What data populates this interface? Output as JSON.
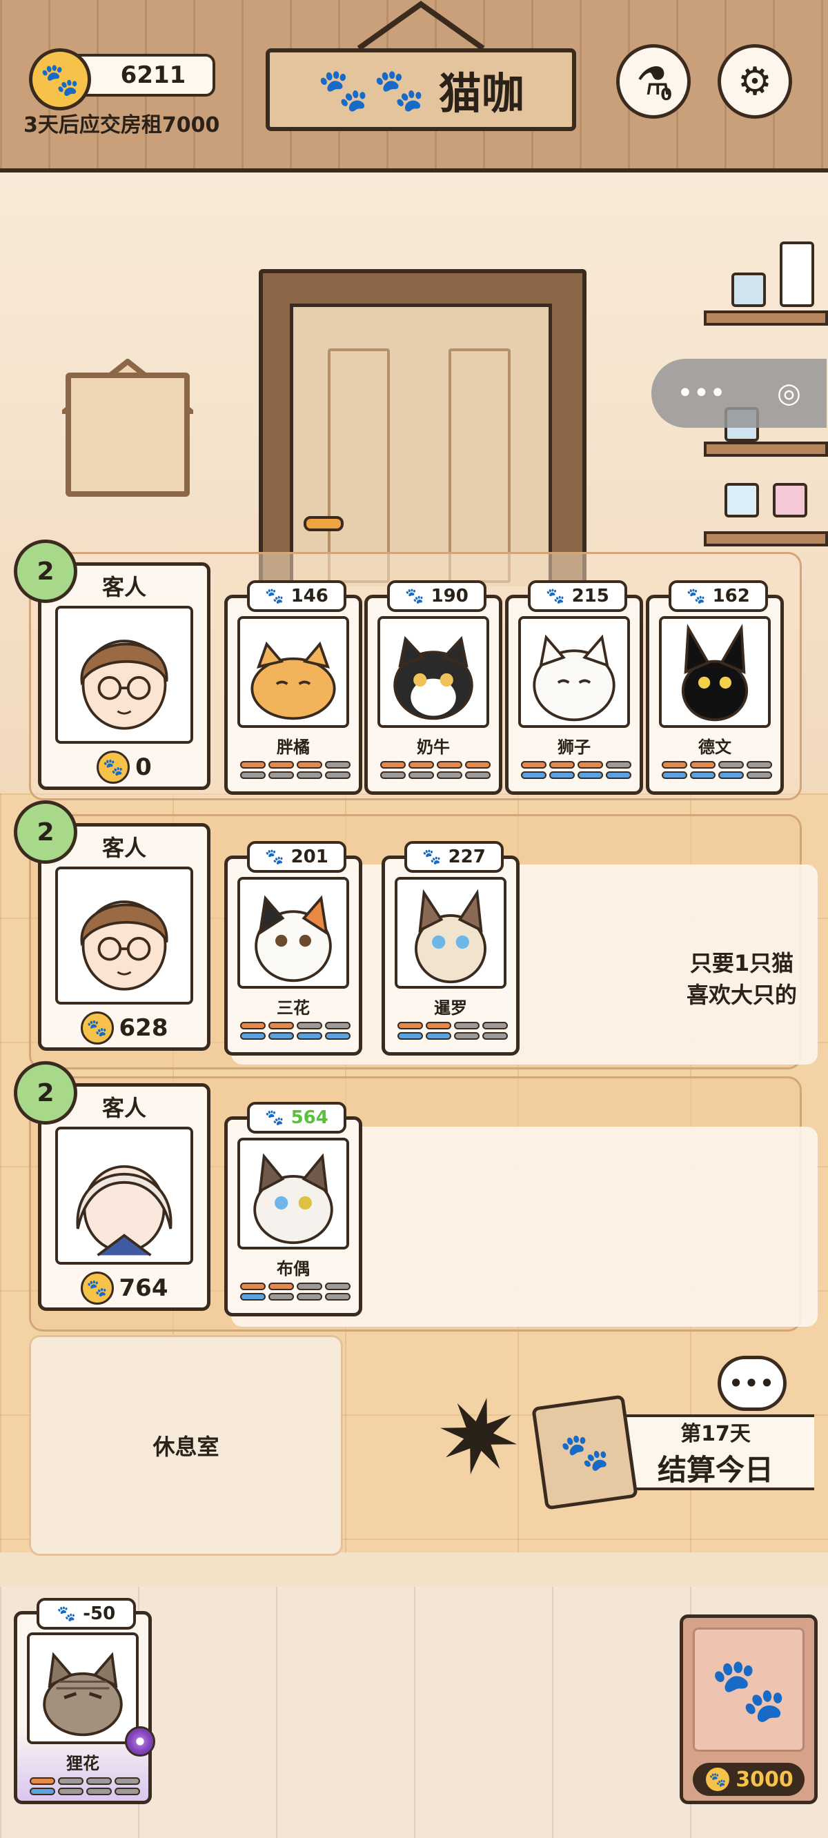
{
  "header": {
    "coins": "6211",
    "rent_notice": "3天后应交房租7000",
    "title": "猫咖",
    "title_paws": "🐾🐾",
    "potion_count": "0"
  },
  "icons": {
    "coin": "paw-coin-icon",
    "potion": "potion-icon",
    "settings": "gear-icon",
    "refresh": "refresh-icon",
    "chat": "speech-bubble-icon",
    "clipboard": "clipboard-paw-icon"
  },
  "colors": {
    "coin": "#f6c24a",
    "refresh": "#a8d88a",
    "stat_orange": "#e8874a",
    "stat_blue": "#5aa3e0",
    "stat_empty": "#9b9b9b",
    "highlight_value": "#58c23a"
  },
  "customers": [
    {
      "title": "客人",
      "refresh_count": "2",
      "coins": "0",
      "request": "",
      "cats": [
        {
          "name": "胖橘",
          "value": "146",
          "orange": 3,
          "blue": 0
        },
        {
          "name": "奶牛",
          "value": "190",
          "orange": 4,
          "blue": 0
        },
        {
          "name": "狮子",
          "value": "215",
          "orange": 3,
          "blue": 4
        },
        {
          "name": "德文",
          "value": "162",
          "orange": 2,
          "blue": 3
        }
      ]
    },
    {
      "title": "客人",
      "refresh_count": "2",
      "coins": "628",
      "request": "只要1只猫\n喜欢大只的",
      "cats": [
        {
          "name": "三花",
          "value": "201",
          "orange": 2,
          "blue": 4
        },
        {
          "name": "暹罗",
          "value": "227",
          "orange": 2,
          "blue": 2
        }
      ]
    },
    {
      "title": "客人",
      "refresh_count": "2",
      "coins": "764",
      "request": "",
      "cats": [
        {
          "name": "布偶",
          "value": "564",
          "orange": 2,
          "blue": 1
        }
      ]
    }
  ],
  "restroom": {
    "label": "休息室"
  },
  "end_day": {
    "day": "第17天",
    "label": "结算今日",
    "chat": "•••"
  },
  "hand_cat": {
    "name": "狸花",
    "value": "-50",
    "orange": 1,
    "blue": 1
  },
  "shop": {
    "price": "3000"
  },
  "mini_menu": {
    "more": "•••",
    "close": "◎"
  }
}
